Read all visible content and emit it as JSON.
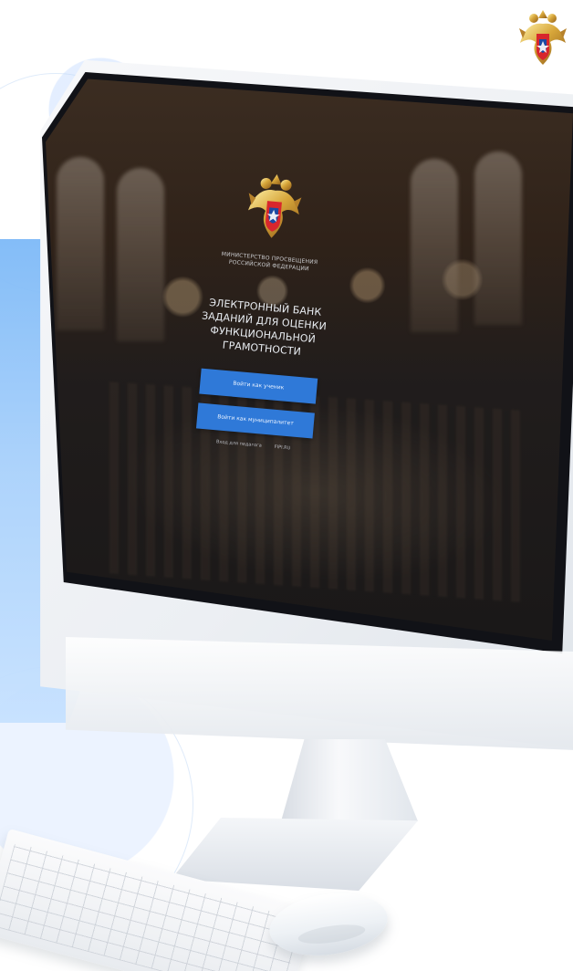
{
  "brand": {
    "emblem_label": "",
    "colors": {
      "accent": "#2f79d8",
      "background_panel": "#a9d1fb",
      "screen_text": "#e9edf2"
    }
  },
  "screen": {
    "ministry_text": "МИНИСТЕРСТВО ПРОСВЕЩЕНИЯ\nРОССИЙСКОЙ ФЕДЕРАЦИИ",
    "title": "ЭЛЕКТРОННЫЙ БАНК\nЗАДАНИЙ ДЛЯ ОЦЕНКИ\nФУНКЦИОНАЛЬНОЙ ГРАМОТНОСТИ",
    "buttons": [
      {
        "label": "Войти как ученик"
      },
      {
        "label": "Войти как муниципалитет"
      }
    ],
    "links": [
      {
        "label": "Вход для педагога"
      },
      {
        "label": "FIPI.RU"
      }
    ]
  },
  "icons": {
    "corner_emblem": "coat-of-arms-icon",
    "screen_emblem": "coat-of-arms-icon"
  }
}
